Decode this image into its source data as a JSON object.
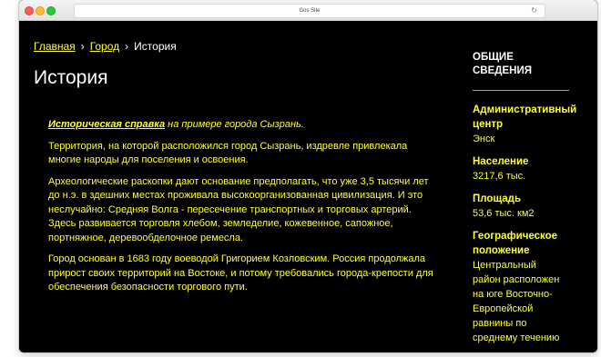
{
  "browser": {
    "url": "Gos Site"
  },
  "breadcrumb": {
    "home": "Главная",
    "sep1": "›",
    "city": "Город",
    "sep2": "›",
    "current": "История"
  },
  "page": {
    "title": "История"
  },
  "article": {
    "intro_link": "Историческая справка",
    "intro_rest": " на примере города Сызрань.",
    "p1": "Территория, на которой расположился город Сызрань, издревле привлекала многие народы для поселения и освоения.",
    "p2a": "Археологические раскопки дают основание предполагать, что уже 3,5 тысячи лет до н.э. в здешних местах проживала высокоорганизованная цивилизация. И это неслучайно: Средняя Волга - пересечение транспортных и торговых артерий.",
    "p2b": "Здесь развивается торговля хлебом, земледелие, кожевенное, сапожное, портняжное, деревообделочное ремесла.",
    "p3": "Город основан в 1683 году воеводой Григорием Козловским. Россия продолжала прирост своих территорий на Востоке, и потому требовались города-крепости для обеспечения безопасности торгового пути."
  },
  "sidebar": {
    "heading": "ОБЩИЕ СВЕДЕНИЯ",
    "admin_label": "Административный центр",
    "admin_value": "Энск",
    "population_label": "Население",
    "population_value": "3217,6 тыс.",
    "area_label": "Площадь",
    "area_value": "53,6 тыс. км2",
    "geo_label": "Географическое положение",
    "geo_value": "Центральный район расположен на юге Восточно-Европейской равнины по среднему течению"
  },
  "colors": {
    "background": "#000000",
    "accent_yellow": "#ffff33",
    "text_white": "#ffffff"
  },
  "icons": {
    "reload": "reload-icon"
  }
}
